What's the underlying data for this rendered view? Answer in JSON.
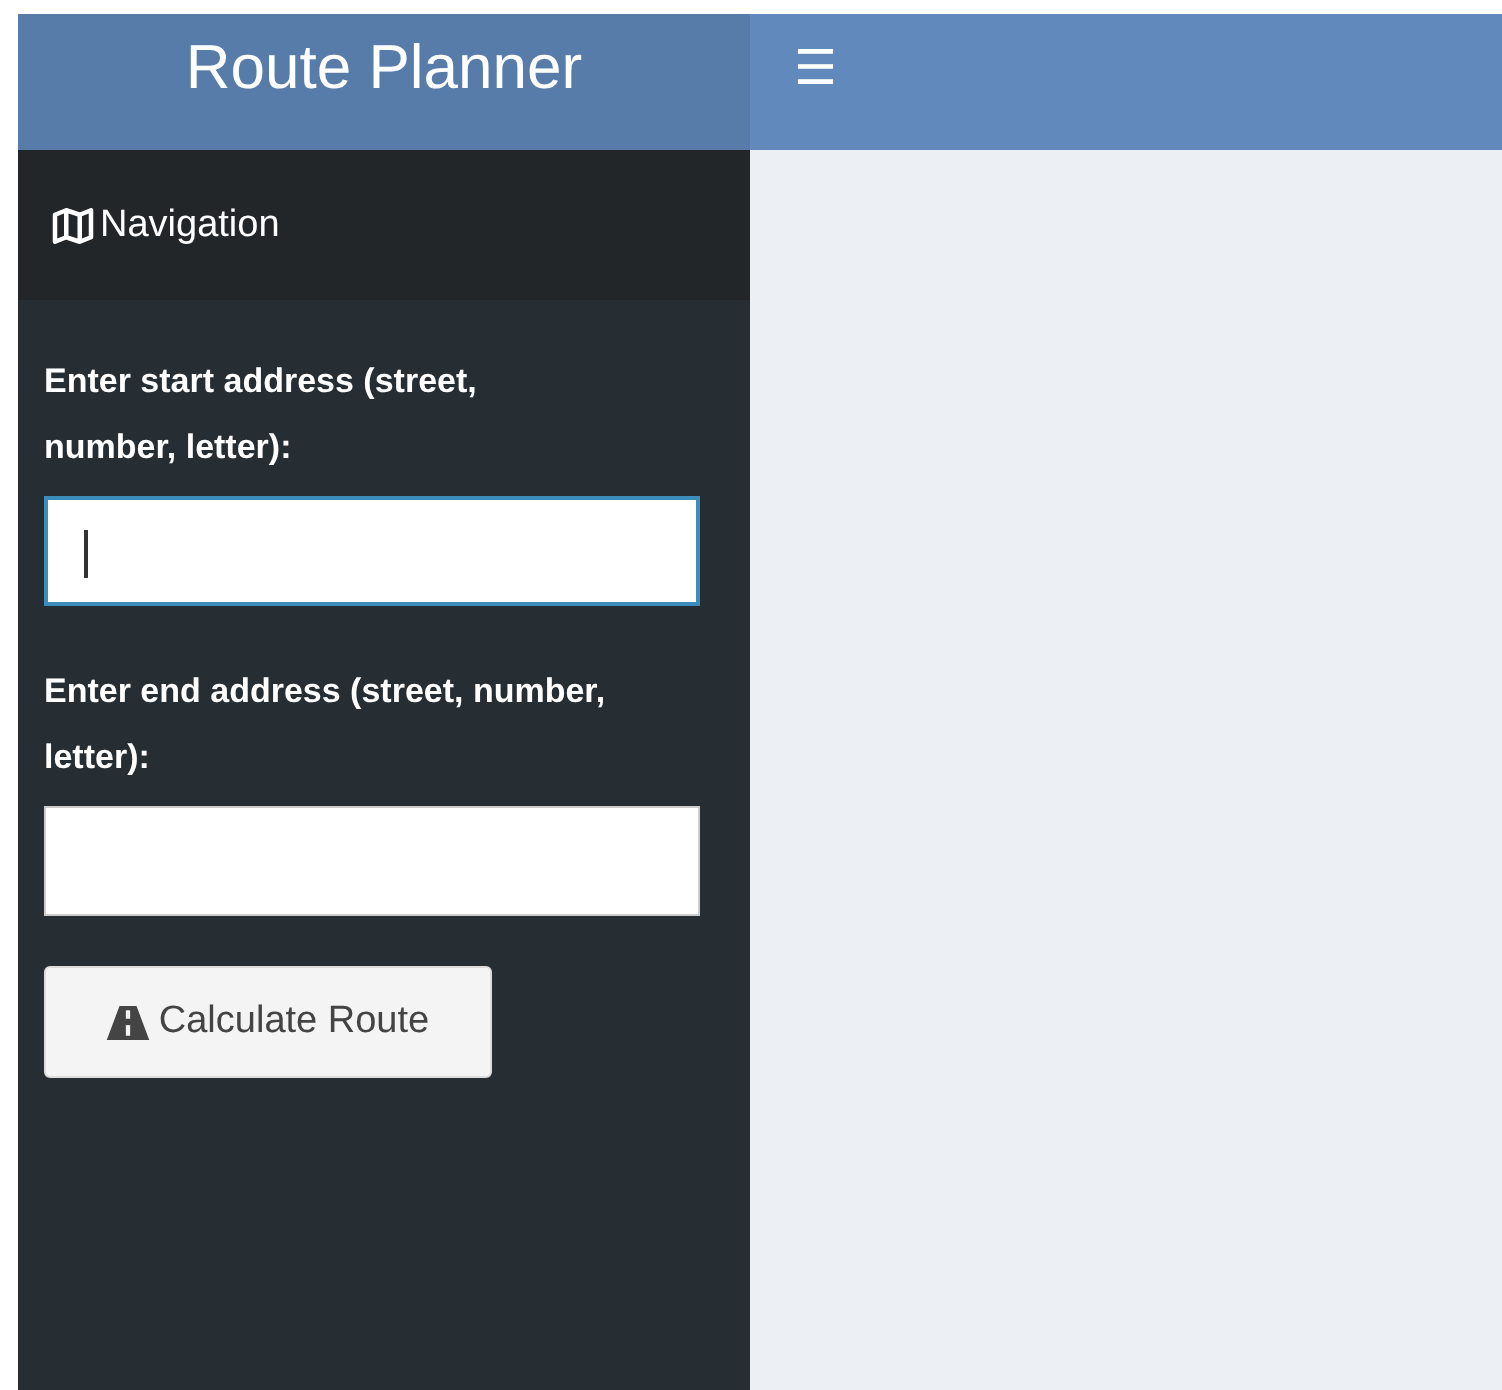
{
  "header": {
    "title": "Route Planner",
    "menu_icon": "☰"
  },
  "sidebar": {
    "section": "Navigation",
    "fields": [
      {
        "label": "Enter start address (street, number, letter):",
        "focused": true
      },
      {
        "label": "Enter end address (street, number, letter):",
        "focused": false
      }
    ],
    "button": "Calculate Route"
  }
}
